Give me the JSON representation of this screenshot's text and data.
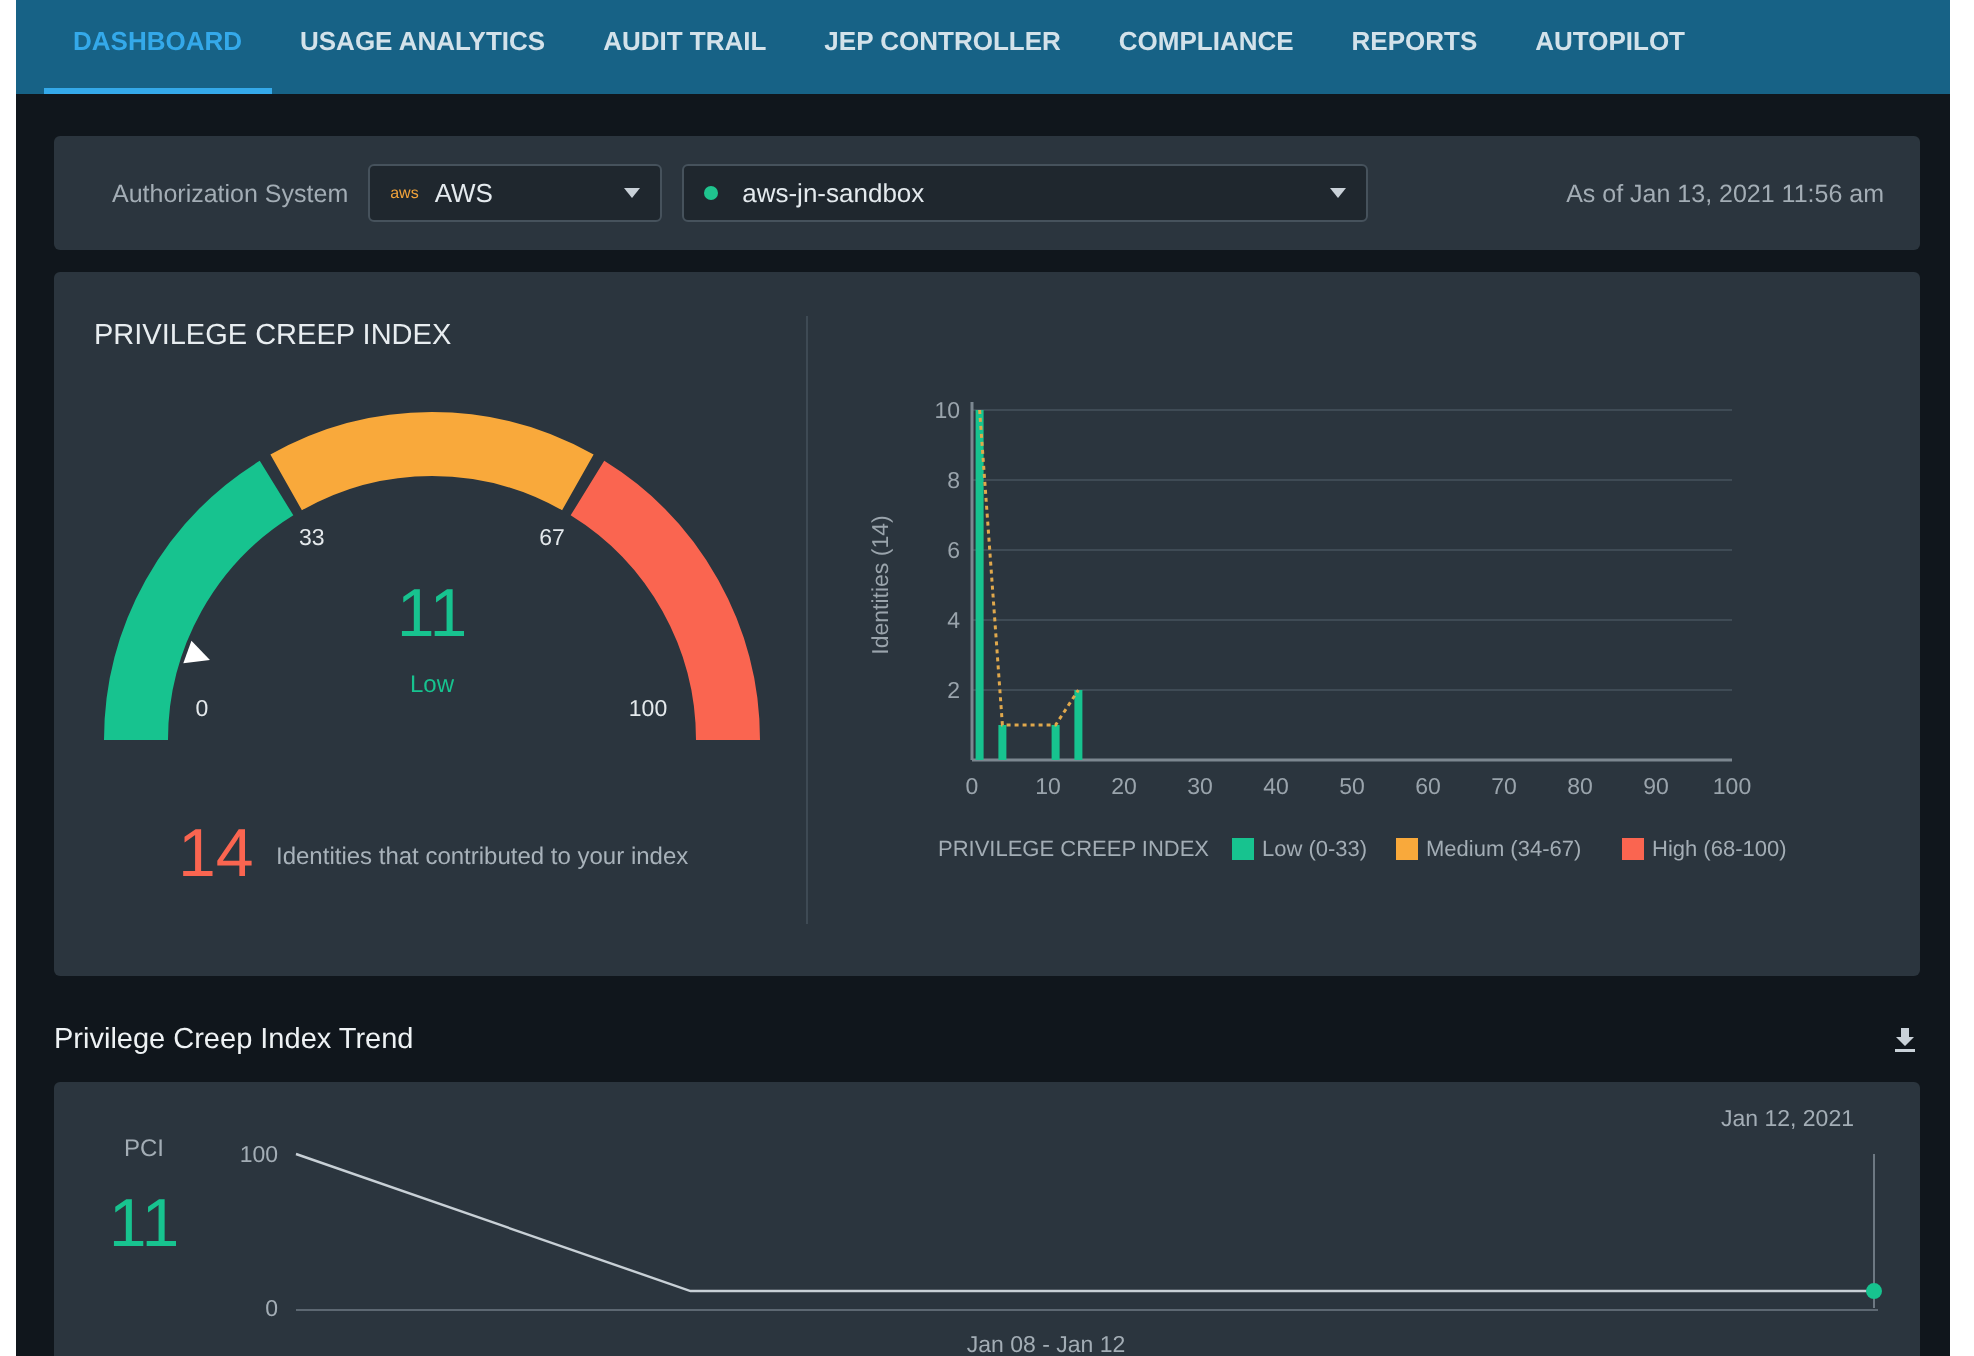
{
  "tabs": [
    {
      "label": "DASHBOARD",
      "selected": true
    },
    {
      "label": "USAGE ANALYTICS",
      "selected": false
    },
    {
      "label": "AUDIT TRAIL",
      "selected": false
    },
    {
      "label": "JEP CONTROLLER",
      "selected": false
    },
    {
      "label": "COMPLIANCE",
      "selected": false
    },
    {
      "label": "REPORTS",
      "selected": false
    },
    {
      "label": "AUTOPILOT",
      "selected": false
    }
  ],
  "filter_bar": {
    "label": "Authorization System",
    "system": {
      "icon_text": "aws",
      "value": "AWS"
    },
    "account": {
      "value": "aws-jn-sandbox",
      "color": "#1fc48e"
    },
    "as_of": "As of Jan 13, 2021 11:56 am"
  },
  "pci_card": {
    "title": "PRIVILEGE CREEP INDEX",
    "gauge": {
      "value": "11",
      "rating": "Low",
      "ticks": [
        "0",
        "33",
        "67",
        "100"
      ],
      "segments": [
        {
          "color": "#17c38f"
        },
        {
          "color": "#f9a93b"
        },
        {
          "color": "#fa6550"
        }
      ]
    },
    "identities_count": "14",
    "identities_text": "Identities that contributed to your index",
    "chart_data": {
      "type": "bar",
      "ylabel": "Identities (14)",
      "x": [
        1,
        4,
        11,
        14
      ],
      "values": [
        10,
        1,
        1,
        2
      ],
      "xlim": [
        0,
        100
      ],
      "ylim": [
        0,
        10
      ],
      "xticks": [
        0,
        10,
        20,
        30,
        40,
        50,
        60,
        70,
        80,
        90,
        100
      ],
      "yticks": [
        2,
        4,
        6,
        8,
        10
      ],
      "grid": true,
      "color": "#17c38f"
    },
    "legend": {
      "title": "PRIVILEGE CREEP INDEX",
      "items": [
        {
          "label": "Low (0-33)",
          "color": "#17c38f"
        },
        {
          "label": "Medium (34-67)",
          "color": "#f9a93b"
        },
        {
          "label": "High (68-100)",
          "color": "#fa6550"
        }
      ]
    }
  },
  "trend": {
    "title": "Privilege Creep Index Trend",
    "pci_label": "PCI",
    "pci_value": "11",
    "chart_data": {
      "type": "line",
      "xlabel": "Jan 08 - Jan 12",
      "ylim": [
        0,
        100
      ],
      "yticks": [
        0,
        100
      ],
      "series": [
        {
          "color": "#c8d0d6",
          "values": [
            100,
            11,
            11,
            11,
            11
          ]
        }
      ],
      "annotations": [
        "Jan 12, 2021"
      ]
    }
  }
}
